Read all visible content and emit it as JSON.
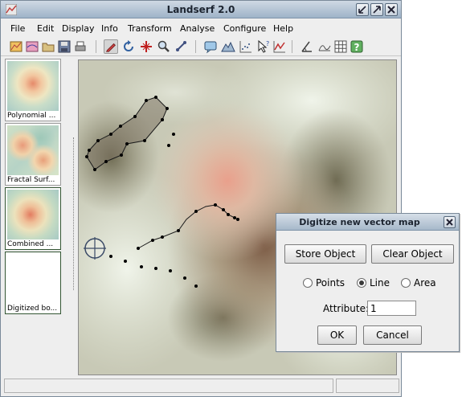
{
  "window": {
    "title": "Landserf 2.0"
  },
  "menu": {
    "items": [
      {
        "label": "File"
      },
      {
        "label": "Edit"
      },
      {
        "label": "Display"
      },
      {
        "label": "Info"
      },
      {
        "label": "Transform"
      },
      {
        "label": "Analyse"
      },
      {
        "label": "Configure"
      },
      {
        "label": "Help"
      }
    ]
  },
  "toolbar": {
    "icons": [
      "new-raster-icon",
      "new-vector-icon",
      "open-folder-icon",
      "save-icon",
      "print-icon",
      "digitize-pencil-icon",
      "rotate-icon",
      "crosshair-icon",
      "zoom-icon",
      "pan-icon",
      "query-info-icon",
      "terrain-icon",
      "scatter-icon",
      "help-cursor-icon",
      "graph-icon",
      "angle-icon",
      "grid-icon",
      "help-icon"
    ]
  },
  "thumbnails": [
    {
      "label": "Polynomial ..."
    },
    {
      "label": "Fractal Surf..."
    },
    {
      "label": "Combined ..."
    },
    {
      "label": "Digitized bo..."
    }
  ],
  "dialog": {
    "title": "Digitize new vector map",
    "store_button": "Store Object",
    "clear_button": "Clear Object",
    "radio_options": [
      "Points",
      "Line",
      "Area"
    ],
    "selected_option": "Line",
    "attribute_label": "Attribute:",
    "attribute_value": "1",
    "ok_button": "OK",
    "cancel_button": "Cancel"
  },
  "colors": {
    "title_gradient_top": "#cfd9e4",
    "title_gradient_bottom": "#9fb3c8",
    "map_peak": "#e9a08c",
    "map_valley": "#7b6a4e",
    "map_light": "#e9efe2",
    "vector": "#000000"
  }
}
